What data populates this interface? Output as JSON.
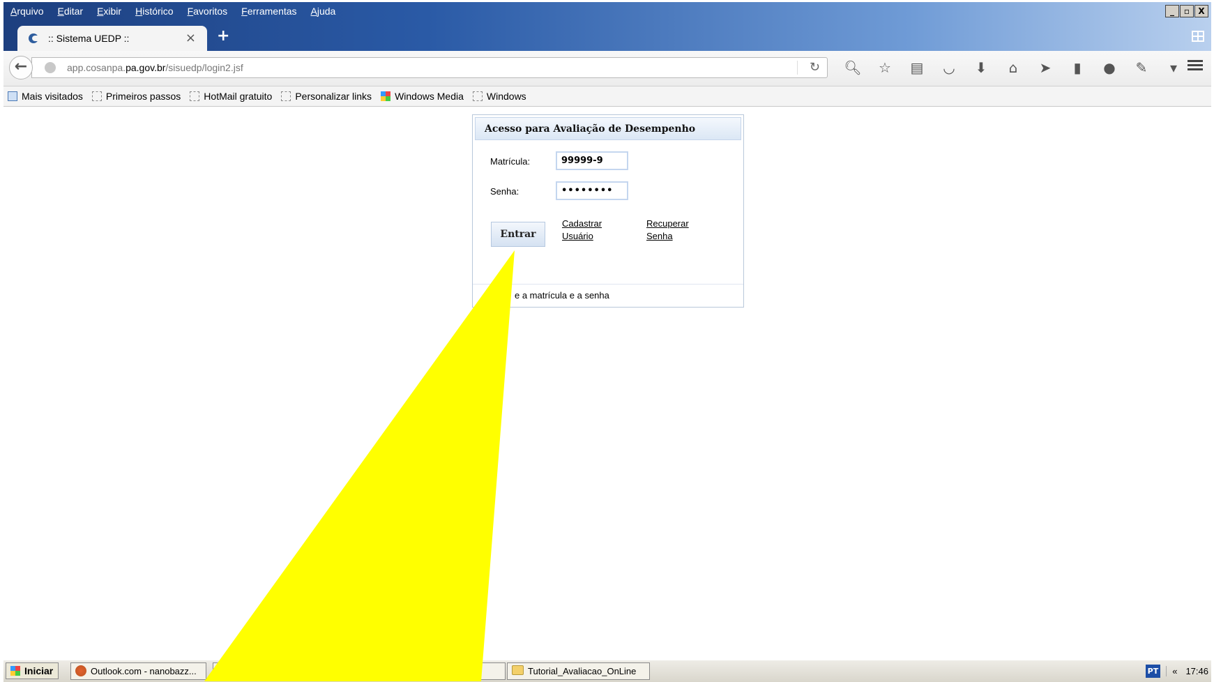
{
  "menu": [
    "Arquivo",
    "Editar",
    "Exibir",
    "Histórico",
    "Favoritos",
    "Ferramentas",
    "Ajuda"
  ],
  "window_buttons": [
    "_",
    "▫",
    "X"
  ],
  "tab": {
    "title": ":: Sistema UEDP ::",
    "close": "×",
    "new_tab": "+"
  },
  "nav": {
    "back": "←",
    "url_prefix": "app.cosanpa.",
    "url_domain": "pa.gov.br",
    "url_path": "/sisuedp/login2.jsf",
    "reload": "↻",
    "icons": [
      "search-icon",
      "star-icon",
      "reading-list-icon",
      "pocket-icon",
      "download-icon",
      "home-icon",
      "send-icon",
      "bookmark-icon",
      "chat-icon",
      "extension-icon"
    ]
  },
  "bookmarks": [
    "Mais visitados",
    "Primeiros passos",
    "HotMail gratuito",
    "Personalizar links",
    "Windows Media",
    "Windows"
  ],
  "login": {
    "title": "Acesso para Avaliação de Desempenho",
    "matricula_label": "Matrícula:",
    "matricula_value": "99999-9",
    "senha_label": "Senha:",
    "senha_value": "••••••••",
    "entrar": "Entrar",
    "cadastrar_line1": "Cadastrar",
    "cadastrar_line2": "Usuário",
    "recuperar_line1": "Recuperar",
    "recuperar_line2": "Senha",
    "footer": "e a matrícula e a senha"
  },
  "taskbar": {
    "start": "Iniciar",
    "task1": "Outlook.com - nanobazz...",
    "task2": "Tutorial_Avaliacao_OnLine",
    "lang": "PT",
    "chevron": "«",
    "clock": "17:46"
  },
  "annotation_color": "#ffff00"
}
